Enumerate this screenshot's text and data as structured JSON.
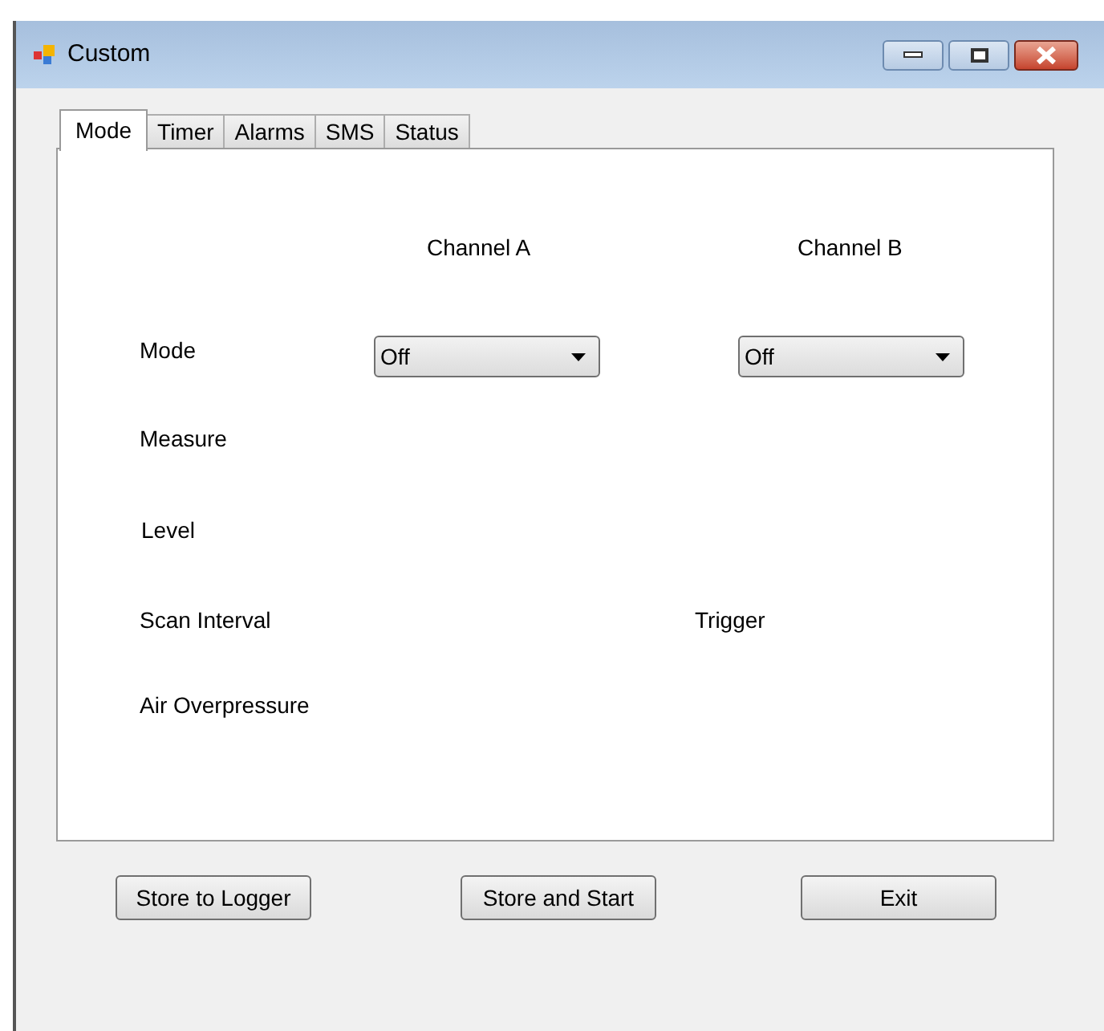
{
  "window": {
    "title": "Custom"
  },
  "tabs": [
    {
      "label": "Mode",
      "selected": true
    },
    {
      "label": "Timer",
      "selected": false
    },
    {
      "label": "Alarms",
      "selected": false
    },
    {
      "label": "SMS",
      "selected": false
    },
    {
      "label": "Status",
      "selected": false
    }
  ],
  "columns": [
    "Channel A",
    "Channel B"
  ],
  "rows": [
    "Mode",
    "Measure",
    "Level",
    "Scan Interval",
    "Air Overpressure"
  ],
  "mode_dropdowns": [
    {
      "value": "Off"
    },
    {
      "value": "Off"
    }
  ],
  "trigger_label": "Trigger",
  "buttons": [
    "Store to Logger",
    "Store and Start",
    "Exit"
  ]
}
